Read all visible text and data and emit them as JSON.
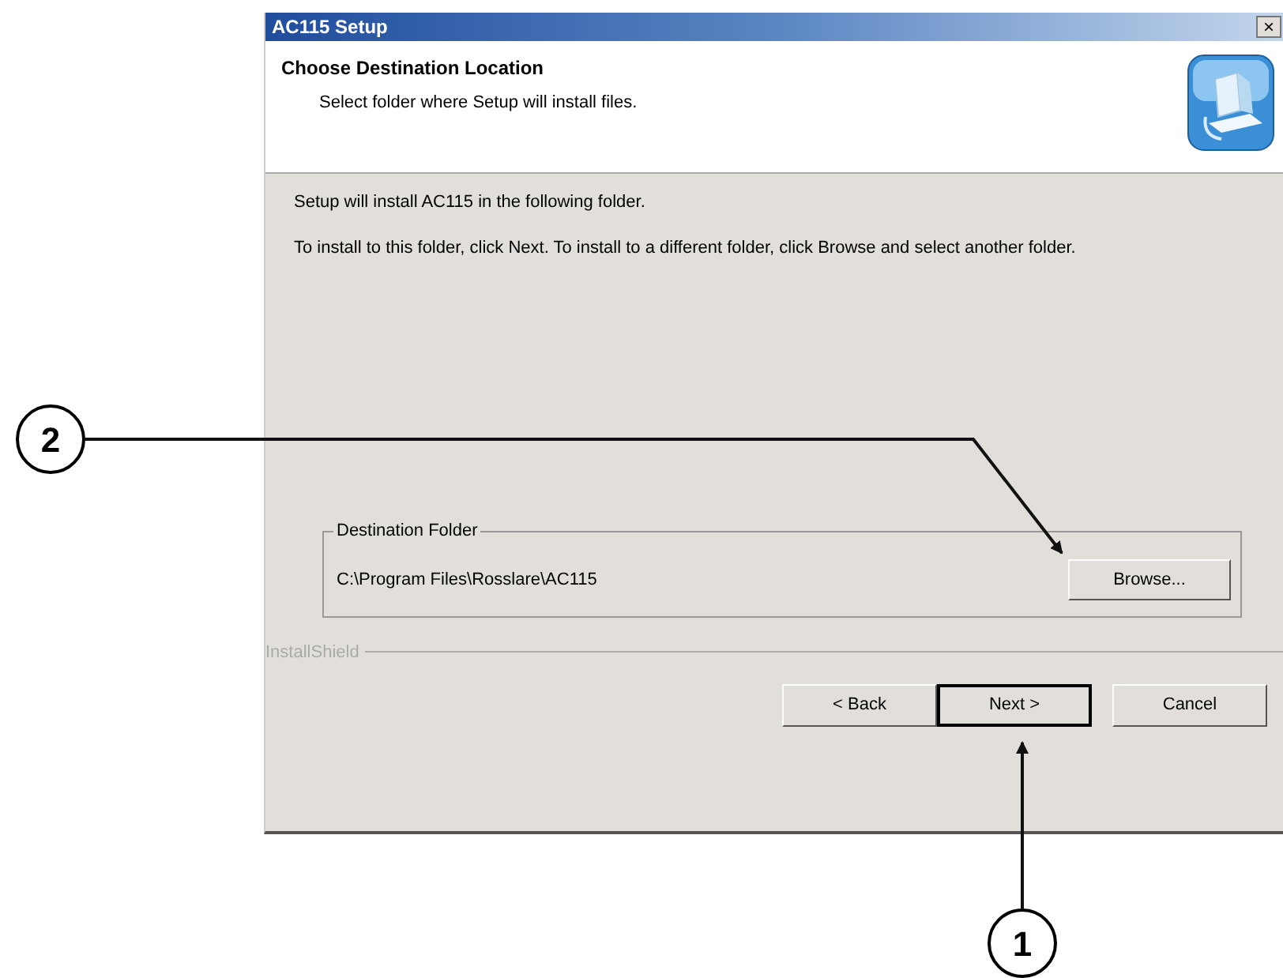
{
  "window": {
    "title": "AC115 Setup",
    "close": "×"
  },
  "header": {
    "title": "Choose Destination Location",
    "subtitle": "Select folder where Setup will install files."
  },
  "body": {
    "paragraphs": [
      "Setup will install AC115 in the following folder.",
      "To install to this folder, click Next. To install to a different folder, click Browse and select another folder."
    ]
  },
  "destination_folder": {
    "label": "Destination Folder",
    "path": "C:\\Program Files\\Rosslare\\AC115",
    "browse_button": "Browse..."
  },
  "brand": "InstallShield",
  "buttons": [
    {
      "label": "< Back",
      "default": false
    },
    {
      "label": "Next >",
      "default": true
    },
    {
      "label": "Cancel",
      "default": false
    }
  ],
  "callouts": [
    {
      "number": "2"
    },
    {
      "number": "1"
    }
  ]
}
